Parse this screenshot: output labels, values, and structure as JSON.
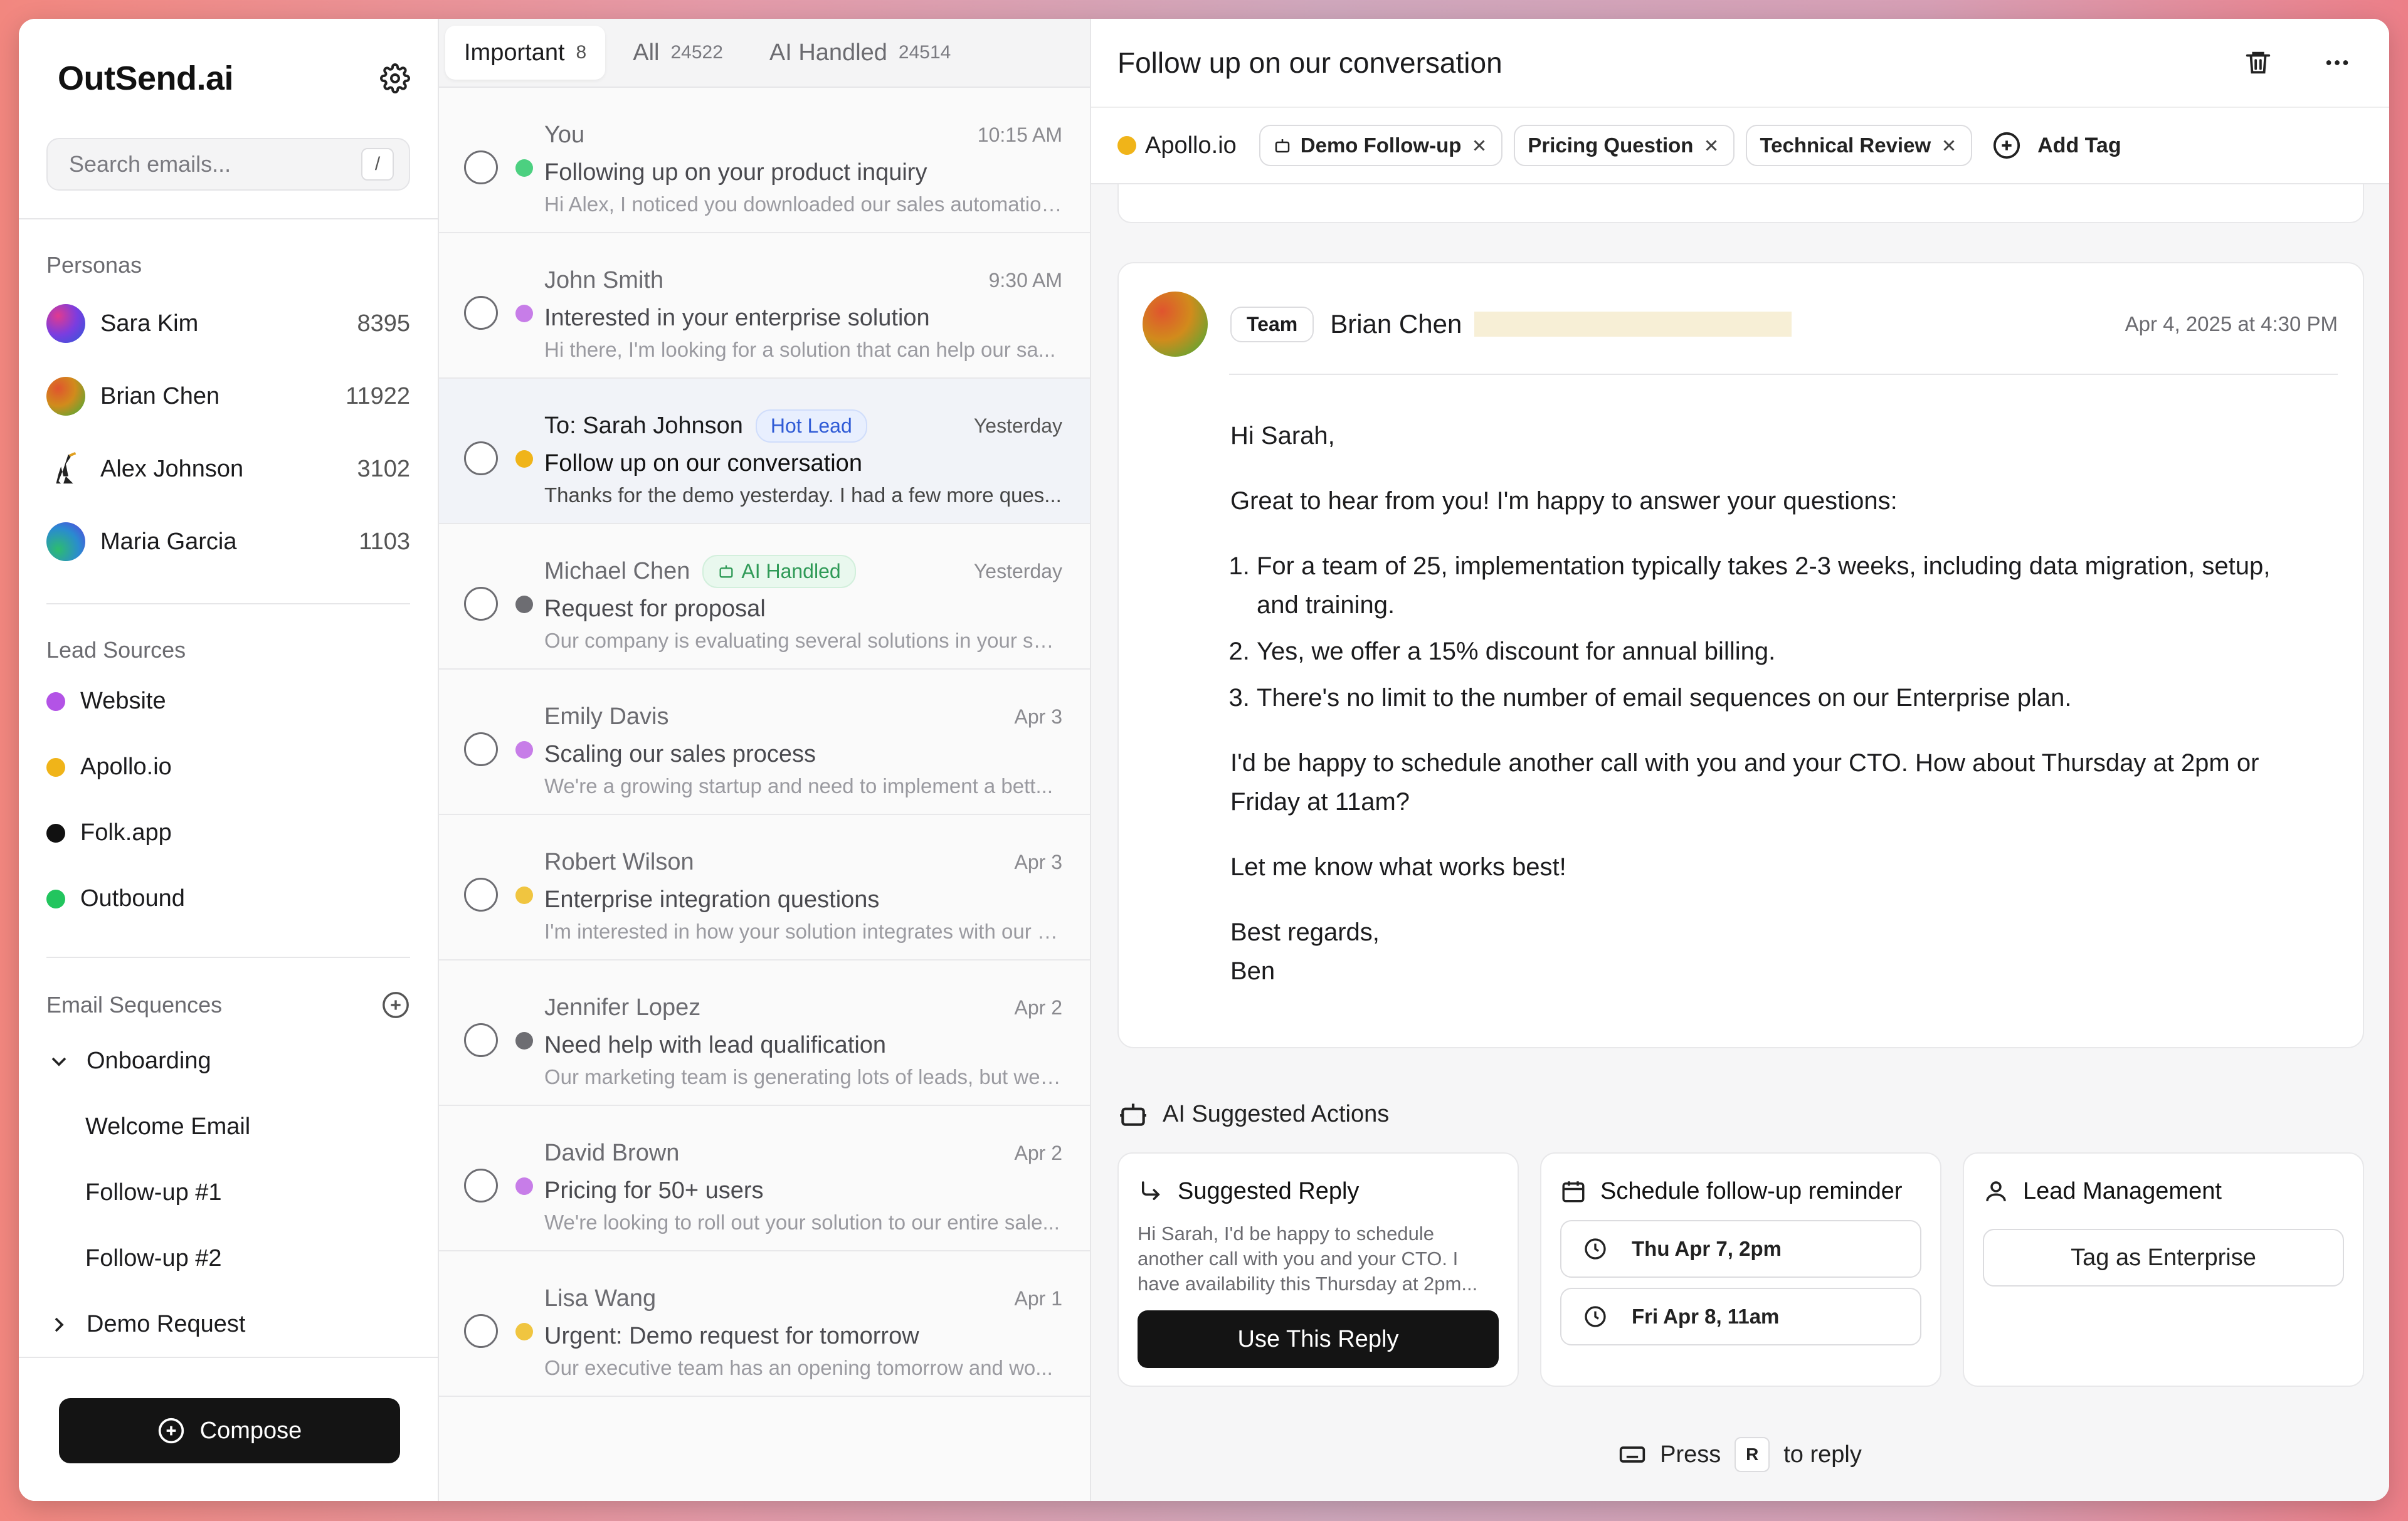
{
  "app": {
    "brand": "OutSend.ai",
    "search_placeholder": "Search emails...",
    "search_shortcut": "/",
    "compose_label": "Compose"
  },
  "personas": {
    "title": "Personas",
    "items": [
      {
        "name": "Sara Kim",
        "count": "8395",
        "avatar": "gradient-purple-blue"
      },
      {
        "name": "Brian Chen",
        "count": "11922",
        "avatar": "gradient-orange-green"
      },
      {
        "name": "Alex Johnson",
        "count": "3102",
        "avatar": "figure-icon"
      },
      {
        "name": "Maria Garcia",
        "count": "1103",
        "avatar": "gradient-green-blue"
      }
    ]
  },
  "lead_sources": {
    "title": "Lead Sources",
    "items": [
      {
        "name": "Website",
        "color": "#b353e6"
      },
      {
        "name": "Apollo.io",
        "color": "#f0b419"
      },
      {
        "name": "Folk.app",
        "color": "#111111"
      },
      {
        "name": "Outbound",
        "color": "#22c55e"
      }
    ]
  },
  "sequences": {
    "title": "Email Sequences",
    "groups": [
      {
        "name": "Onboarding",
        "expanded": true,
        "children": [
          "Welcome Email",
          "Follow-up #1",
          "Follow-up #2"
        ]
      },
      {
        "name": "Demo Request",
        "expanded": false,
        "children": []
      }
    ]
  },
  "tabs": [
    {
      "label": "Important",
      "count": "8",
      "active": true
    },
    {
      "label": "All",
      "count": "24522",
      "active": false
    },
    {
      "label": "AI Handled",
      "count": "24514",
      "active": false
    }
  ],
  "emails": [
    {
      "from": "You",
      "time": "10:15 AM",
      "subject": "Following up on your product inquiry",
      "preview": "Hi Alex, I noticed you downloaded our sales automation...",
      "dot": "#4cd080",
      "badge": ""
    },
    {
      "from": "John Smith",
      "time": "9:30 AM",
      "subject": "Interested in your enterprise solution",
      "preview": "Hi there, I'm looking for a solution that can help our sa...",
      "dot": "#c77de8",
      "badge": ""
    },
    {
      "from": "To: Sarah Johnson",
      "time": "Yesterday",
      "subject": "Follow up on our conversation",
      "preview": "Thanks for the demo yesterday. I had a few more ques...",
      "dot": "#f0b419",
      "badge": "Hot Lead",
      "selected": true
    },
    {
      "from": "Michael Chen",
      "time": "Yesterday",
      "subject": "Request for proposal",
      "preview": "Our company is evaluating several solutions in your spa...",
      "dot": "#6d6d72",
      "badge": "AI Handled"
    },
    {
      "from": "Emily Davis",
      "time": "Apr 3",
      "subject": "Scaling our sales process",
      "preview": "We're a growing startup and need to implement a bett...",
      "dot": "#c77de8",
      "badge": ""
    },
    {
      "from": "Robert Wilson",
      "time": "Apr 3",
      "subject": "Enterprise integration questions",
      "preview": "I'm interested in how your solution integrates with our e...",
      "dot": "#f0c540",
      "badge": ""
    },
    {
      "from": "Jennifer Lopez",
      "time": "Apr 2",
      "subject": "Need help with lead qualification",
      "preview": "Our marketing team is generating lots of leads, but we'r...",
      "dot": "#6d6d72",
      "badge": ""
    },
    {
      "from": "David Brown",
      "time": "Apr 2",
      "subject": "Pricing for 50+ users",
      "preview": "We're looking to roll out your solution to our entire sale...",
      "dot": "#c77de8",
      "badge": ""
    },
    {
      "from": "Lisa Wang",
      "time": "Apr 1",
      "subject": "Urgent: Demo request for tomorrow",
      "preview": "Our executive team has an opening tomorrow and wo...",
      "dot": "#f0c540",
      "badge": ""
    }
  ],
  "thread": {
    "title": "Follow up on our conversation",
    "source": "Apollo.io",
    "tags": [
      "Demo Follow-up",
      "Pricing Question",
      "Technical Review"
    ],
    "add_tag_label": "Add Tag",
    "message": {
      "team_label": "Team",
      "sender": "Brian Chen",
      "date": "Apr 4, 2025 at 4:30 PM",
      "greeting": "Hi Sarah,",
      "intro": "Great to hear from you! I'm happy to answer your questions:",
      "points": [
        "For a team of 25, implementation typically takes 2-3 weeks, including data migration, setup, and training.",
        "Yes, we offer a 15% discount for annual billing.",
        "There's no limit to the number of email sequences on our Enterprise plan."
      ],
      "schedule": "I'd be happy to schedule another call with you and your CTO. How about Thursday at 2pm or Friday at 11am?",
      "closing": "Let me know what works best!",
      "signoff": "Best regards,",
      "signature": "Ben"
    }
  },
  "ai_actions": {
    "title": "AI Suggested Actions",
    "reply": {
      "title": "Suggested Reply",
      "text": "Hi Sarah, I'd be happy to schedule another call with you and your CTO. I have availability this Thursday at 2pm...",
      "button": "Use This Reply"
    },
    "reminder": {
      "title": "Schedule follow-up reminder",
      "options": [
        "Thu Apr 7, 2pm",
        "Fri Apr 8, 11am"
      ]
    },
    "lead": {
      "title": "Lead Management",
      "button": "Tag as Enterprise"
    }
  },
  "hint": {
    "press": "Press",
    "key": "R",
    "suffix": "to reply"
  }
}
